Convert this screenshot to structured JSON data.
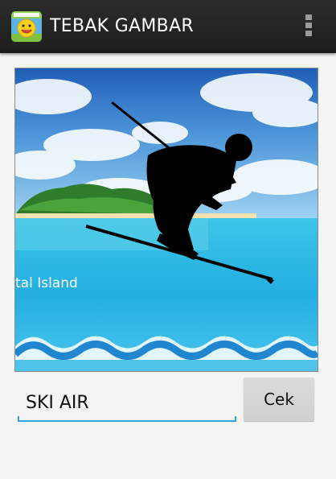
{
  "app": {
    "title": "TEBAK GAMBAR",
    "icon": "smiley-quiz-app-icon"
  },
  "actionbar": {
    "overflow_icon": "more-vert-icon"
  },
  "puzzle": {
    "image_caption": "tal Island",
    "scene": "skier-silhouette-tropical-island"
  },
  "answer": {
    "value": "SKI AIR",
    "placeholder": ""
  },
  "buttons": {
    "check_label": "Cek"
  },
  "colors": {
    "actionbar": "#1e1e1e",
    "accent": "#33a3dc",
    "button": "#d6d6d6"
  }
}
